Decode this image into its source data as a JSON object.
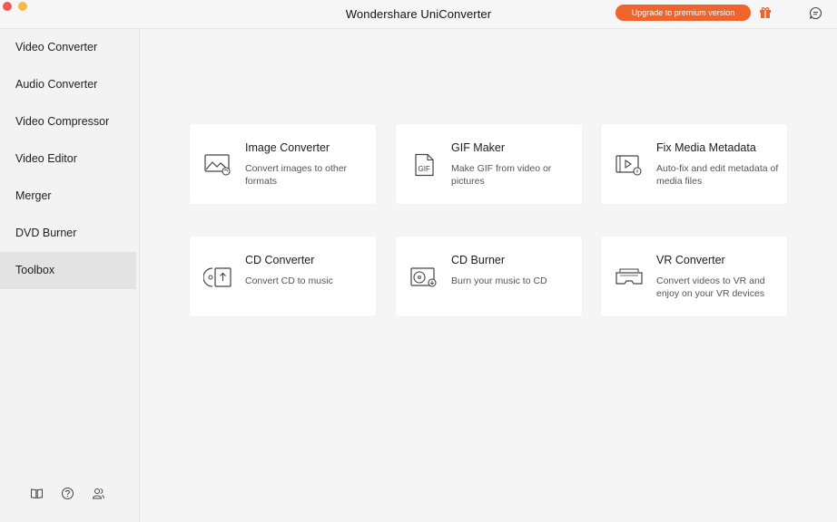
{
  "app": {
    "title": "Wondershare UniConverter",
    "upgrade_label": "Upgrade to premium version",
    "accent_color": "#f0632b"
  },
  "sidebar": {
    "items": [
      {
        "label": "Video Converter"
      },
      {
        "label": "Audio Converter"
      },
      {
        "label": "Video Compressor"
      },
      {
        "label": "Video Editor"
      },
      {
        "label": "Merger"
      },
      {
        "label": "DVD Burner"
      },
      {
        "label": "Toolbox",
        "active": true
      }
    ],
    "footer_icons": [
      "book-icon",
      "help-icon",
      "account-icon"
    ]
  },
  "toolbox": {
    "cards": [
      {
        "title": "Image Converter",
        "desc": "Convert images to other formats",
        "icon": "image-converter-icon"
      },
      {
        "title": "GIF Maker",
        "desc": "Make GIF from video or pictures",
        "icon": "gif-icon"
      },
      {
        "title": "Fix Media Metadata",
        "desc": "Auto-fix and edit metadata of media files",
        "icon": "metadata-icon"
      },
      {
        "title": "CD Converter",
        "desc": "Convert CD to music",
        "icon": "cd-converter-icon"
      },
      {
        "title": "CD Burner",
        "desc": "Burn your music to CD",
        "icon": "cd-burner-icon"
      },
      {
        "title": "VR Converter",
        "desc": "Convert videos to VR and enjoy on your VR devices",
        "icon": "vr-icon"
      }
    ]
  }
}
